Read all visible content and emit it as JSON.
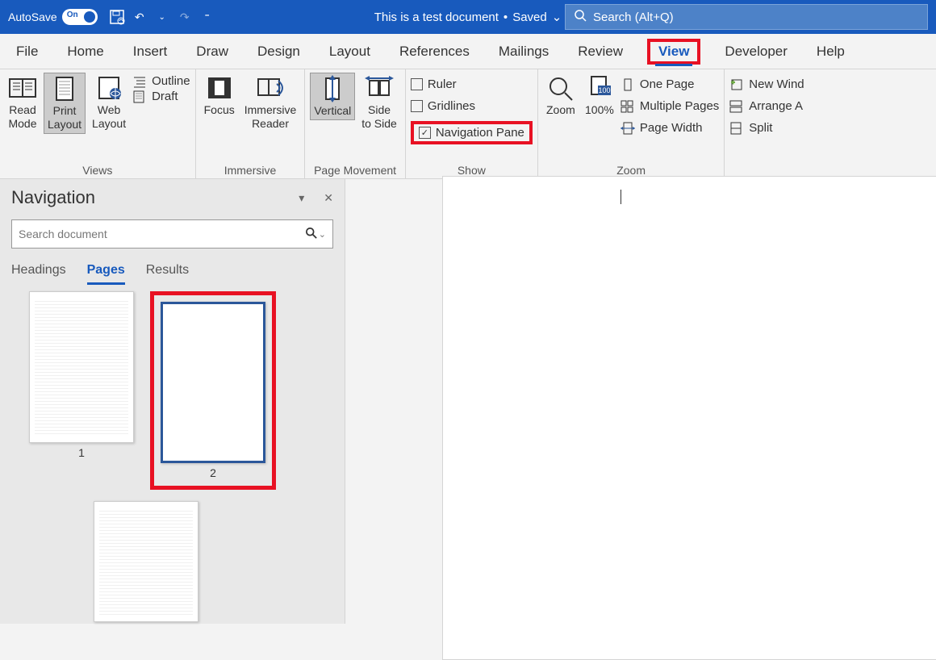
{
  "titlebar": {
    "autosave": "AutoSave",
    "autosave_state": "On",
    "document_title": "This is a test document",
    "saved": "Saved",
    "search_placeholder": "Search (Alt+Q)"
  },
  "tabs": [
    "File",
    "Home",
    "Insert",
    "Draw",
    "Design",
    "Layout",
    "References",
    "Mailings",
    "Review",
    "View",
    "Developer",
    "Help"
  ],
  "active_tab": "View",
  "ribbon": {
    "views": {
      "label": "Views",
      "read_mode": "Read\nMode",
      "print_layout": "Print\nLayout",
      "web_layout": "Web\nLayout",
      "outline": "Outline",
      "draft": "Draft"
    },
    "immersive": {
      "label": "Immersive",
      "focus": "Focus",
      "reader": "Immersive\nReader"
    },
    "page_movement": {
      "label": "Page Movement",
      "vertical": "Vertical",
      "side": "Side\nto Side"
    },
    "show": {
      "label": "Show",
      "ruler": "Ruler",
      "gridlines": "Gridlines",
      "navpane": "Navigation Pane"
    },
    "zoom": {
      "label": "Zoom",
      "zoom": "Zoom",
      "hundred": "100%",
      "one_page": "One Page",
      "multiple": "Multiple Pages",
      "page_width": "Page Width"
    },
    "window": {
      "new_window": "New Wind",
      "arrange": "Arrange A",
      "split": "Split"
    }
  },
  "navigation": {
    "title": "Navigation",
    "search_placeholder": "Search document",
    "tabs": [
      "Headings",
      "Pages",
      "Results"
    ],
    "active": "Pages",
    "page1": "1",
    "page2": "2"
  }
}
